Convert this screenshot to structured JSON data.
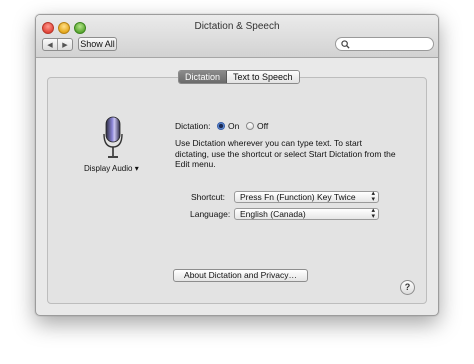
{
  "window": {
    "title": "Dictation & Speech"
  },
  "toolbar": {
    "back_glyph": "◀",
    "forward_glyph": "▶",
    "show_all_label": "Show All",
    "search_placeholder": "",
    "search_icon": "magnifier-icon"
  },
  "tabs": [
    {
      "label": "Dictation",
      "active": true
    },
    {
      "label": "Text to Speech",
      "active": false
    }
  ],
  "mic": {
    "icon": "microphone-icon",
    "source_label": "Display Audio",
    "caret": "▾"
  },
  "dictation": {
    "label": "Dictation:",
    "on_label": "On",
    "off_label": "Off",
    "selected": "On",
    "description": "Use Dictation wherever you can type text. To start dictating, use the shortcut or select Start Dictation from the Edit menu."
  },
  "shortcut": {
    "label": "Shortcut:",
    "value": "Press Fn (Function) Key Twice"
  },
  "language": {
    "label": "Language:",
    "value": "English (Canada)"
  },
  "about_button": "About Dictation and Privacy…",
  "help_glyph": "?",
  "colors": {
    "accent": "#3b73d1",
    "mic_glow": "#7a6fd8"
  }
}
